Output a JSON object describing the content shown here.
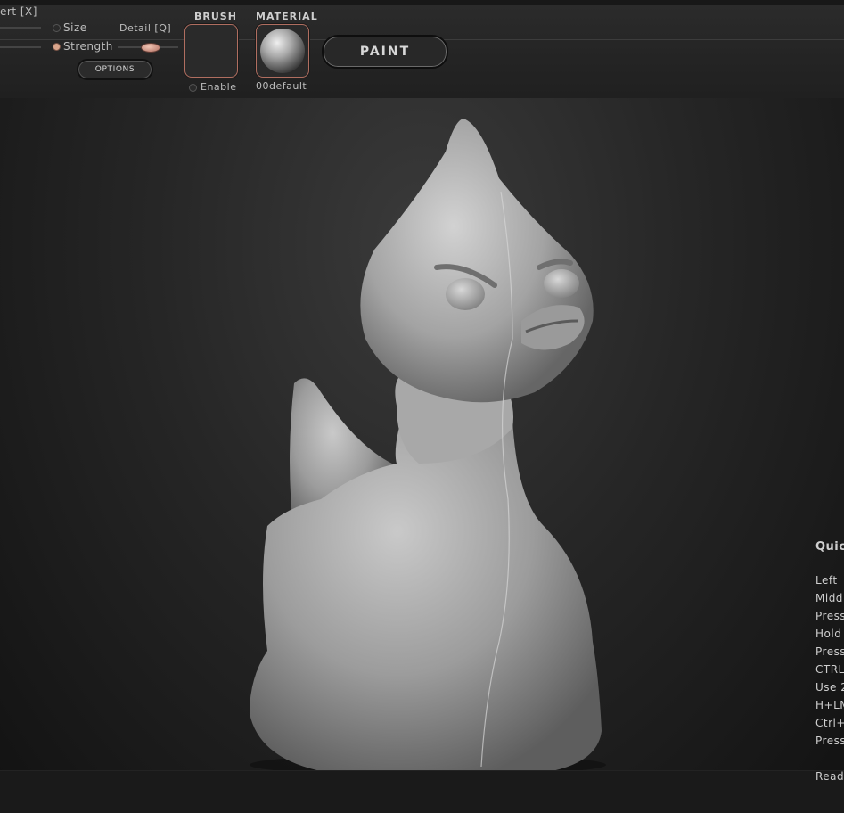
{
  "toolbar": {
    "invert_label": "ert [X]",
    "size_label": "Size",
    "detail_label": "Detail [Q]",
    "strength_label": "Strength",
    "strength_value": 0.5,
    "options_label": "OPTIONS",
    "brush_heading": "BRUSH",
    "enable_label": "Enable",
    "material_heading": "MATERIAL",
    "material_name": "00default",
    "paint_label": "PAINT",
    "accent_color": "#d9a58c"
  },
  "help_panel": {
    "title": "Quic",
    "lines": [
      "Left",
      "Midd",
      "Press",
      "Hold",
      "Press",
      "CTRL",
      "Use 2",
      "H+LM",
      "Ctrl+",
      "Press"
    ],
    "footer": "Read"
  }
}
